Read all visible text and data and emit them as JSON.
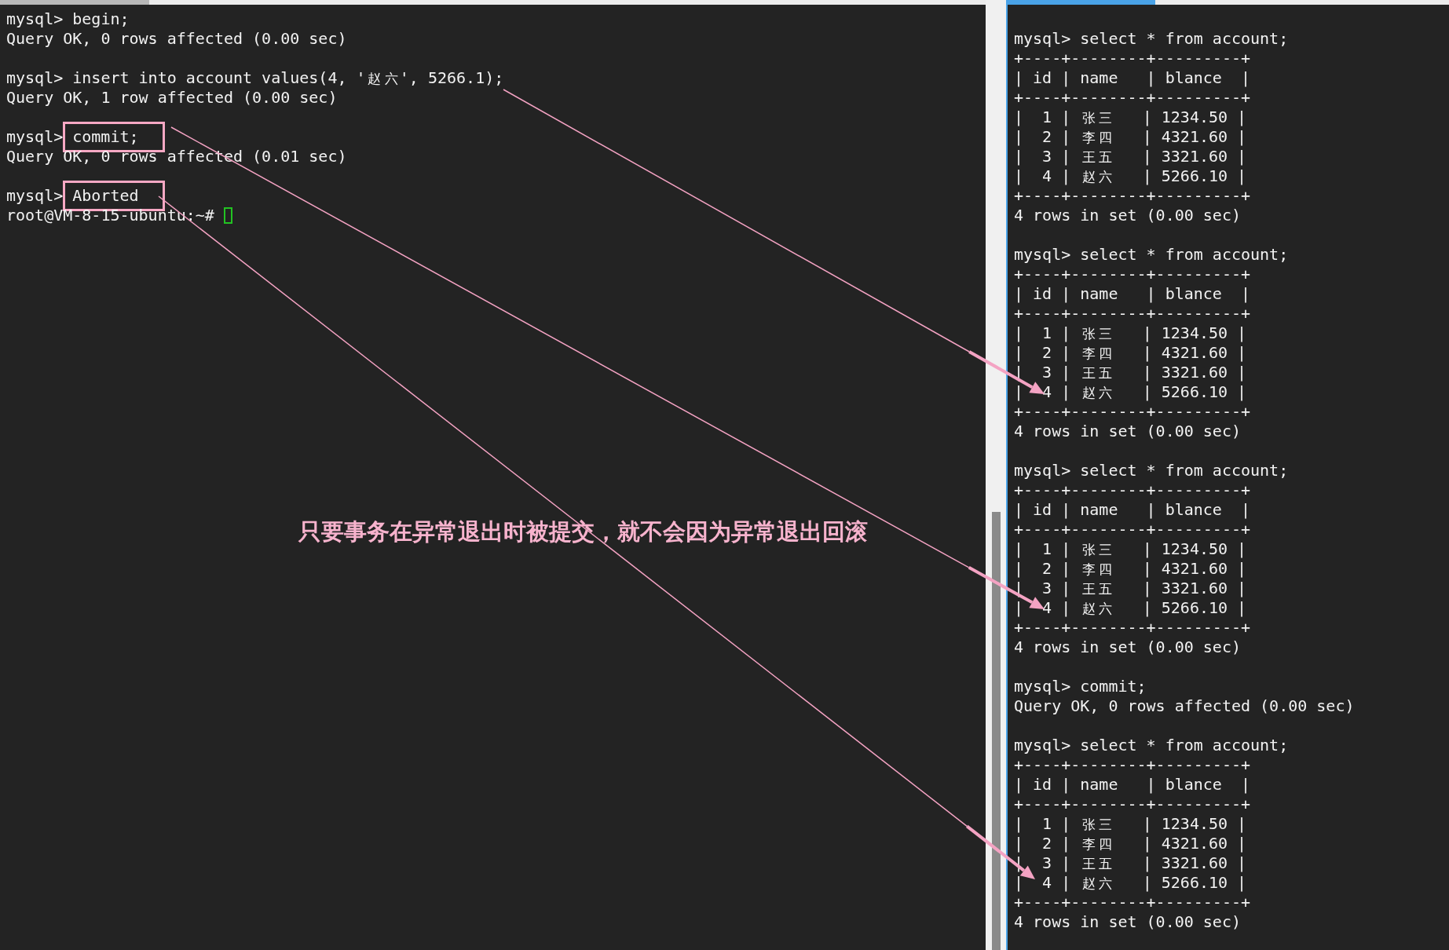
{
  "left_terminal": {
    "lines": [
      {
        "kind": "text",
        "text": "mysql> begin;"
      },
      {
        "kind": "text",
        "text": "Query OK, 0 rows affected (0.00 sec)"
      },
      {
        "kind": "blank"
      },
      {
        "kind": "text",
        "text": "mysql> insert into account values(4, '赵六', 5266.1);"
      },
      {
        "kind": "text",
        "text": "Query OK, 1 row affected (0.00 sec)"
      },
      {
        "kind": "blank"
      },
      {
        "kind": "highlight",
        "prompt": "mysql>",
        "command": "commit;"
      },
      {
        "kind": "text",
        "text": "Query OK, 0 rows affected (0.01 sec)"
      },
      {
        "kind": "blank"
      },
      {
        "kind": "highlight",
        "prompt": "mysql>",
        "command": "Aborted"
      },
      {
        "kind": "text",
        "text": "root@VM-8-15-ubuntu:~# ",
        "cursor": true
      }
    ]
  },
  "annotation": {
    "text": "只要事务在异常退出时被提交，就不会因为异常退出回滚"
  },
  "right_terminal": {
    "lines": [
      {
        "kind": "text",
        "text": "mysql> select * from account;"
      },
      {
        "kind": "text",
        "text": "+----+--------+---------+"
      },
      {
        "kind": "text",
        "text": "| id | name   | blance  |"
      },
      {
        "kind": "text",
        "text": "+----+--------+---------+"
      },
      {
        "kind": "text",
        "text": "|  1 | 张三   | 1234.50 |"
      },
      {
        "kind": "text",
        "text": "|  2 | 李四   | 4321.60 |"
      },
      {
        "kind": "text",
        "text": "|  3 | 王五   | 3321.60 |"
      },
      {
        "kind": "text",
        "text": "|  4 | 赵六   | 5266.10 |"
      },
      {
        "kind": "text",
        "text": "+----+--------+---------+"
      },
      {
        "kind": "text",
        "text": "4 rows in set (0.00 sec)"
      },
      {
        "kind": "blank"
      },
      {
        "kind": "text",
        "text": "mysql> select * from account;"
      },
      {
        "kind": "text",
        "text": "+----+--------+---------+"
      },
      {
        "kind": "text",
        "text": "| id | name   | blance  |"
      },
      {
        "kind": "text",
        "text": "+----+--------+---------+"
      },
      {
        "kind": "text",
        "text": "|  1 | 张三   | 1234.50 |"
      },
      {
        "kind": "text",
        "text": "|  2 | 李四   | 4321.60 |"
      },
      {
        "kind": "text",
        "text": "|  3 | 王五   | 3321.60 |"
      },
      {
        "kind": "text",
        "text": "|  4 | 赵六   | 5266.10 |"
      },
      {
        "kind": "text",
        "text": "+----+--------+---------+"
      },
      {
        "kind": "text",
        "text": "4 rows in set (0.00 sec)"
      },
      {
        "kind": "blank"
      },
      {
        "kind": "text",
        "text": "mysql> select * from account;"
      },
      {
        "kind": "text",
        "text": "+----+--------+---------+"
      },
      {
        "kind": "text",
        "text": "| id | name   | blance  |"
      },
      {
        "kind": "text",
        "text": "+----+--------+---------+"
      },
      {
        "kind": "text",
        "text": "|  1 | 张三   | 1234.50 |"
      },
      {
        "kind": "text",
        "text": "|  2 | 李四   | 4321.60 |"
      },
      {
        "kind": "text",
        "text": "|  3 | 王五   | 3321.60 |"
      },
      {
        "kind": "text",
        "text": "|  4 | 赵六   | 5266.10 |"
      },
      {
        "kind": "text",
        "text": "+----+--------+---------+"
      },
      {
        "kind": "text",
        "text": "4 rows in set (0.00 sec)"
      },
      {
        "kind": "blank"
      },
      {
        "kind": "text",
        "text": "mysql> commit;"
      },
      {
        "kind": "text",
        "text": "Query OK, 0 rows affected (0.00 sec)"
      },
      {
        "kind": "blank"
      },
      {
        "kind": "text",
        "text": "mysql> select * from account;"
      },
      {
        "kind": "text",
        "text": "+----+--------+---------+"
      },
      {
        "kind": "text",
        "text": "| id | name   | blance  |"
      },
      {
        "kind": "text",
        "text": "+----+--------+---------+"
      },
      {
        "kind": "text",
        "text": "|  1 | 张三   | 1234.50 |"
      },
      {
        "kind": "text",
        "text": "|  2 | 李四   | 4321.60 |"
      },
      {
        "kind": "text",
        "text": "|  3 | 王五   | 3321.60 |"
      },
      {
        "kind": "text",
        "text": "|  4 | 赵六   | 5266.10 |"
      },
      {
        "kind": "text",
        "text": "+----+--------+---------+"
      },
      {
        "kind": "text",
        "text": "4 rows in set (0.00 sec)"
      }
    ]
  }
}
